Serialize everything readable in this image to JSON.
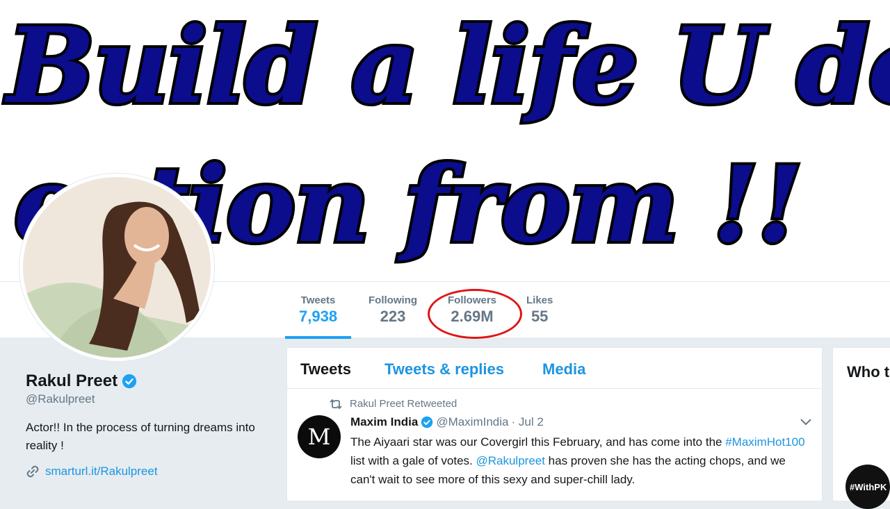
{
  "banner": {
    "line1": "Build a life U don't ne",
    "line2": "ection from !!"
  },
  "nav": {
    "stats": [
      {
        "label": "Tweets",
        "value": "7,938"
      },
      {
        "label": "Following",
        "value": "223"
      },
      {
        "label": "Followers",
        "value": "2.69M"
      },
      {
        "label": "Likes",
        "value": "55"
      }
    ]
  },
  "profile": {
    "name": "Rakul Preet",
    "handle": "@Rakulpreet",
    "bio": "Actor!! In the process of turning dreams into reality !",
    "link": "smarturl.it/Rakulpreet"
  },
  "timeline": {
    "tabs": [
      "Tweets",
      "Tweets & replies",
      "Media"
    ],
    "tweet": {
      "retweet_context": "Rakul Preet Retweeted",
      "avatar_letter": "M",
      "author_name": "Maxim India",
      "author_handle": "@MaximIndia",
      "date": "· Jul 2",
      "text_1": "The Aiyaari star was our Covergirl this February, and has come into the ",
      "hashtag": "#MaximHot100",
      "text_2": " list with a gale of votes. ",
      "mention": "@Rakulpreet",
      "text_3": " has proven she has the acting chops, and we can't wait to see more of this sexy and super-chill lady."
    }
  },
  "right_panel": {
    "title": "Who t",
    "avatar_text": "#WithPK"
  },
  "colors": {
    "accent": "#1da1f2",
    "link": "#1b95e0",
    "banner_text": "#0b0d8c",
    "highlight_circle": "#e01414"
  },
  "icons": [
    "verified-badge-icon",
    "link-icon",
    "retweet-icon",
    "chevron-down-icon"
  ]
}
